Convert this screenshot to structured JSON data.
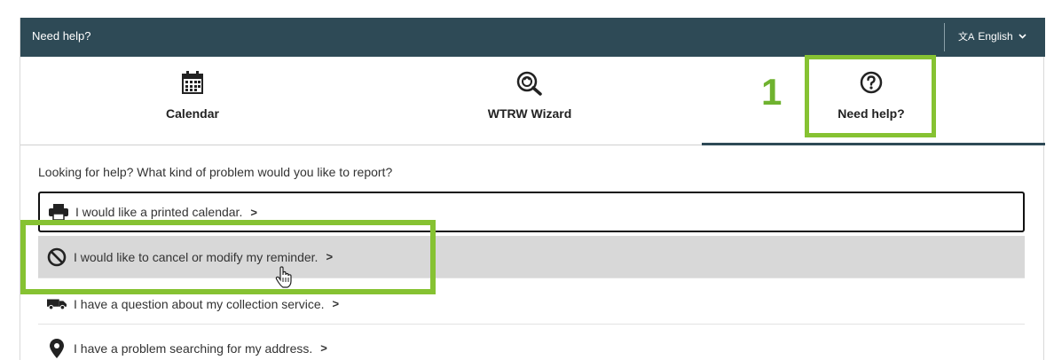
{
  "topbar": {
    "title": "Need help?",
    "language": "English",
    "language_icon": "translate-icon",
    "chevron_icon": "chevron-down-icon"
  },
  "tabs": [
    {
      "label": "Calendar",
      "icon": "calendar-icon"
    },
    {
      "label": "WTRW Wizard",
      "icon": "recycle-search-icon"
    },
    {
      "label": "Need help?",
      "icon": "question-circle-icon",
      "active": true
    }
  ],
  "annotation": {
    "step_number": "1",
    "highlight_color": "#86c232"
  },
  "main": {
    "question": "Looking for help? What kind of problem would you like to report?",
    "options": [
      {
        "label": "I would like a printed calendar.",
        "icon": "printer-icon",
        "arrow": ">"
      },
      {
        "label": "I would like to cancel or modify my reminder.",
        "icon": "prohibited-icon",
        "arrow": ">"
      },
      {
        "label": "I have a question about my collection service.",
        "icon": "truck-icon",
        "arrow": ">"
      },
      {
        "label": "I have a problem searching for my address.",
        "icon": "map-pin-icon",
        "arrow": ">"
      }
    ]
  },
  "colors": {
    "topbar_bg": "#2e4a56",
    "hover_row_bg": "#d8d8d8",
    "accent_green": "#86c232"
  }
}
